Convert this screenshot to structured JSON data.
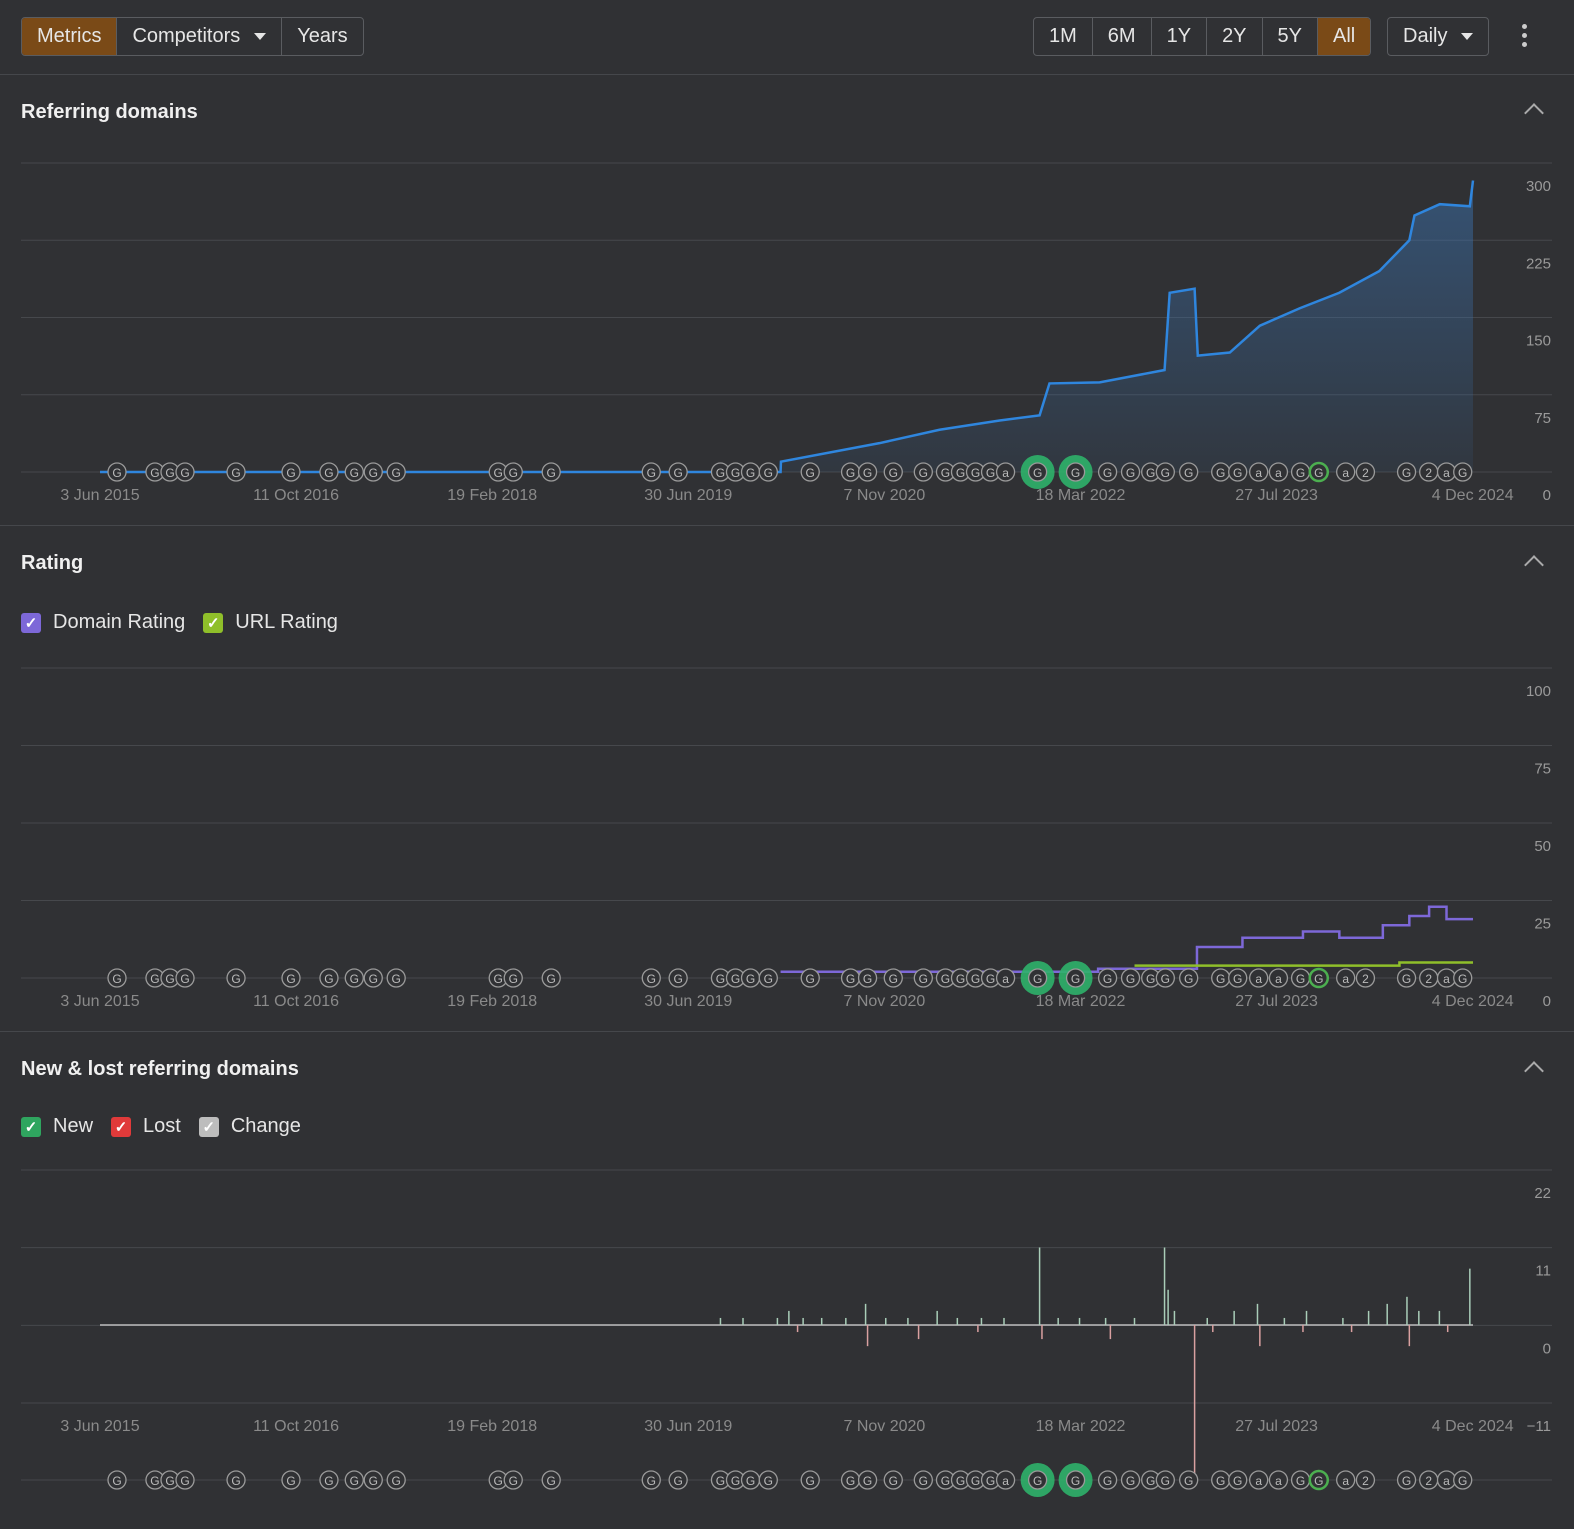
{
  "toolbar": {
    "view_tabs": [
      {
        "label": "Metrics",
        "active": true
      },
      {
        "label": "Competitors",
        "dropdown": true
      },
      {
        "label": "Years"
      }
    ],
    "ranges": [
      {
        "label": "1M"
      },
      {
        "label": "6M"
      },
      {
        "label": "1Y"
      },
      {
        "label": "2Y"
      },
      {
        "label": "5Y"
      },
      {
        "label": "All",
        "active": true
      }
    ],
    "interval": "Daily",
    "accent": "#7a4a17"
  },
  "x_ticks": [
    "3 Jun 2015",
    "11 Oct 2016",
    "19 Feb 2018",
    "30 Jun 2019",
    "7 Nov 2020",
    "18 Mar 2022",
    "27 Jul 2023",
    "4 Dec 2024"
  ],
  "markers": [
    {
      "date": "2015-07-16",
      "label": "G"
    },
    {
      "date": "2015-10-20",
      "label": "G"
    },
    {
      "date": "2015-11-27",
      "label": "G"
    },
    {
      "date": "2016-01-04",
      "label": "G"
    },
    {
      "date": "2016-05-12",
      "label": "G"
    },
    {
      "date": "2016-09-28",
      "label": "G"
    },
    {
      "date": "2017-01-02",
      "label": "G"
    },
    {
      "date": "2017-03-07",
      "label": "G"
    },
    {
      "date": "2017-04-24",
      "label": "G"
    },
    {
      "date": "2017-06-21",
      "label": "G"
    },
    {
      "date": "2018-03-06",
      "label": "G"
    },
    {
      "date": "2018-04-13",
      "label": "G"
    },
    {
      "date": "2018-07-18",
      "label": "G"
    },
    {
      "date": "2019-03-28",
      "label": "G"
    },
    {
      "date": "2019-06-04",
      "label": "G"
    },
    {
      "date": "2019-09-19",
      "label": "G"
    },
    {
      "date": "2019-10-27",
      "label": "G"
    },
    {
      "date": "2019-12-04",
      "label": "G"
    },
    {
      "date": "2020-01-18",
      "label": "G"
    },
    {
      "date": "2020-05-03",
      "label": "G"
    },
    {
      "date": "2020-08-13",
      "label": "G"
    },
    {
      "date": "2020-09-25",
      "label": "G"
    },
    {
      "date": "2020-11-29",
      "label": "G"
    },
    {
      "date": "2021-02-13",
      "label": "G"
    },
    {
      "date": "2021-04-10",
      "label": "G"
    },
    {
      "date": "2021-05-18",
      "label": "G"
    },
    {
      "date": "2021-06-25",
      "label": "G"
    },
    {
      "date": "2021-08-02",
      "label": "G"
    },
    {
      "date": "2021-09-09",
      "label": "a"
    },
    {
      "date": "2021-11-29",
      "label": "G",
      "highlight": "big"
    },
    {
      "date": "2022-03-05",
      "label": "G",
      "highlight": "big"
    },
    {
      "date": "2022-05-25",
      "label": "G"
    },
    {
      "date": "2022-07-22",
      "label": "G"
    },
    {
      "date": "2022-09-11",
      "label": "G"
    },
    {
      "date": "2022-10-18",
      "label": "G"
    },
    {
      "date": "2022-12-16",
      "label": "G"
    },
    {
      "date": "2023-03-07",
      "label": "G"
    },
    {
      "date": "2023-04-19",
      "label": "G"
    },
    {
      "date": "2023-06-11",
      "label": "a"
    },
    {
      "date": "2023-07-31",
      "label": "a"
    },
    {
      "date": "2023-09-25",
      "label": "G"
    },
    {
      "date": "2023-11-10",
      "label": "G",
      "highlight": "ring"
    },
    {
      "date": "2024-01-17",
      "label": "a"
    },
    {
      "date": "2024-03-07",
      "label": "2"
    },
    {
      "date": "2024-06-19",
      "label": "G"
    },
    {
      "date": "2024-08-14",
      "label": "2"
    },
    {
      "date": "2024-09-28",
      "label": "a"
    },
    {
      "date": "2024-11-08",
      "label": "G"
    }
  ],
  "chart_data": [
    {
      "title": "Referring domains",
      "type": "area",
      "yticks": [
        300,
        225,
        150,
        75,
        0
      ],
      "ylim": [
        0,
        300
      ],
      "xlim": [
        "2015-06-03",
        "2024-12-04"
      ],
      "grid": true,
      "color": "#2f86de",
      "series": [
        {
          "values": [
            [
              "2015-06-03",
              0
            ],
            [
              "2020-02-18",
              0
            ],
            [
              "2020-02-19",
              10
            ],
            [
              "2020-10-25",
              28
            ],
            [
              "2021-03-26",
              41
            ],
            [
              "2021-08-25",
              50
            ],
            [
              "2021-12-04",
              55
            ],
            [
              "2021-12-29",
              86
            ],
            [
              "2022-05-05",
              87
            ],
            [
              "2022-10-16",
              99
            ],
            [
              "2022-10-29",
              174
            ],
            [
              "2022-12-31",
              178
            ],
            [
              "2023-01-08",
              113
            ],
            [
              "2023-03-30",
              116
            ],
            [
              "2023-06-14",
              142
            ],
            [
              "2023-09-23",
              159
            ],
            [
              "2024-01-01",
              174
            ],
            [
              "2024-04-11",
              195
            ],
            [
              "2024-06-26",
              225
            ],
            [
              "2024-07-09",
              249
            ],
            [
              "2024-09-11",
              260
            ],
            [
              "2024-11-26",
              258
            ],
            [
              "2024-12-04",
              283
            ]
          ]
        }
      ]
    },
    {
      "title": "Rating",
      "type": "line",
      "yticks": [
        100,
        75,
        50,
        25,
        0
      ],
      "ylim": [
        0,
        100
      ],
      "grid": true,
      "legend": [
        {
          "name": "Domain Rating",
          "color": "#7d68d8",
          "checked": true
        },
        {
          "name": "URL Rating",
          "color": "#8fbf2a",
          "checked": true
        }
      ],
      "series": [
        {
          "name": "Domain Rating",
          "values": [
            [
              "2020-02-18",
              2
            ],
            [
              "2021-06-01",
              2
            ],
            [
              "2022-05-01",
              3
            ],
            [
              "2023-01-05",
              3
            ],
            [
              "2023-01-06",
              10
            ],
            [
              "2023-05-01",
              13
            ],
            [
              "2023-10-01",
              15
            ],
            [
              "2024-01-01",
              13
            ],
            [
              "2024-04-20",
              17
            ],
            [
              "2024-06-26",
              20
            ],
            [
              "2024-08-15",
              23
            ],
            [
              "2024-09-28",
              19
            ],
            [
              "2024-12-04",
              19
            ]
          ]
        },
        {
          "name": "URL Rating",
          "values": [
            [
              "2022-08-01",
              4
            ],
            [
              "2023-06-01",
              4
            ],
            [
              "2024-06-01",
              5
            ],
            [
              "2024-12-04",
              5
            ]
          ]
        }
      ]
    },
    {
      "title": "New & lost referring domains",
      "type": "bar",
      "yticks": [
        22,
        11,
        0,
        -11
      ],
      "ylim": [
        -22,
        22
      ],
      "grid": true,
      "legend": [
        {
          "name": "New",
          "color": "#2fa55f",
          "checked": true
        },
        {
          "name": "Lost",
          "color": "#e03a3a",
          "checked": true
        },
        {
          "name": "Change",
          "color": "#bdbdbd",
          "checked": true
        }
      ],
      "new": [
        [
          "2019-09-19",
          1
        ],
        [
          "2019-11-15",
          1
        ],
        [
          "2020-02-10",
          1
        ],
        [
          "2020-03-10",
          2
        ],
        [
          "2020-04-15",
          1
        ],
        [
          "2020-06-01",
          1
        ],
        [
          "2020-08-01",
          1
        ],
        [
          "2020-09-20",
          3
        ],
        [
          "2020-11-10",
          1
        ],
        [
          "2021-01-05",
          1
        ],
        [
          "2021-03-20",
          2
        ],
        [
          "2021-05-10",
          1
        ],
        [
          "2021-07-10",
          1
        ],
        [
          "2021-09-05",
          1
        ],
        [
          "2021-12-04",
          11
        ],
        [
          "2022-01-20",
          1
        ],
        [
          "2022-03-15",
          1
        ],
        [
          "2022-05-20",
          1
        ],
        [
          "2022-08-01",
          1
        ],
        [
          "2022-10-16",
          11
        ],
        [
          "2022-10-25",
          5
        ],
        [
          "2022-11-10",
          2
        ],
        [
          "2023-02-01",
          1
        ],
        [
          "2023-04-10",
          2
        ],
        [
          "2023-06-08",
          3
        ],
        [
          "2023-08-15",
          1
        ],
        [
          "2023-10-10",
          2
        ],
        [
          "2024-01-10",
          1
        ],
        [
          "2024-03-15",
          2
        ],
        [
          "2024-05-01",
          3
        ],
        [
          "2024-06-20",
          4
        ],
        [
          "2024-07-20",
          2
        ],
        [
          "2024-09-10",
          2
        ],
        [
          "2024-11-26",
          8
        ]
      ],
      "lost": [
        [
          "2020-04-01",
          -1
        ],
        [
          "2020-09-25",
          -3
        ],
        [
          "2021-02-01",
          -2
        ],
        [
          "2021-07-01",
          -1
        ],
        [
          "2021-12-10",
          -2
        ],
        [
          "2022-06-01",
          -2
        ],
        [
          "2022-12-31",
          -21
        ],
        [
          "2023-02-15",
          -1
        ],
        [
          "2023-06-14",
          -3
        ],
        [
          "2023-10-01",
          -1
        ],
        [
          "2024-02-01",
          -1
        ],
        [
          "2024-06-26",
          -3
        ],
        [
          "2024-10-01",
          -1
        ]
      ]
    }
  ]
}
